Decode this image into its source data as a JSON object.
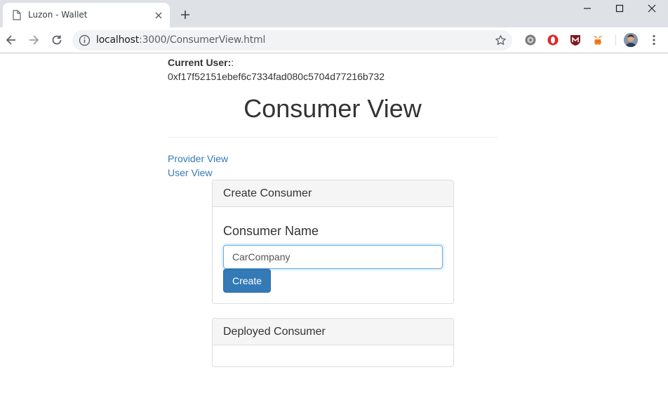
{
  "browser": {
    "tab_title": "Luzon - Wallet",
    "url_host": "localhost",
    "url_rest": ":3000/ConsumerView.html"
  },
  "page": {
    "current_user_label": "Current User:",
    "current_user_suffix": ":",
    "current_user_address": "0xf17f52151ebef6c7334fad080c5704d77216b732",
    "title": "Consumer View",
    "links": [
      "Provider View",
      "User View"
    ],
    "create_panel": {
      "heading": "Create Consumer",
      "field_label": "Consumer Name",
      "field_value": "CarCompany",
      "button_label": "Create"
    },
    "deployed_panel": {
      "heading": "Deployed Consumer"
    }
  },
  "colors": {
    "link": "#337ab7",
    "primary_button": "#337ab7",
    "panel_heading_bg": "#f5f5f5"
  },
  "icons": [
    "page-icon",
    "close-icon",
    "new-tab-icon",
    "minimize-icon",
    "maximize-icon",
    "window-close-icon",
    "back-icon",
    "forward-icon",
    "reload-icon",
    "info-icon",
    "star-icon",
    "settings-extension-icon",
    "opera-extension-icon",
    "mcafee-extension-icon",
    "metamask-extension-icon",
    "menu-icon"
  ]
}
